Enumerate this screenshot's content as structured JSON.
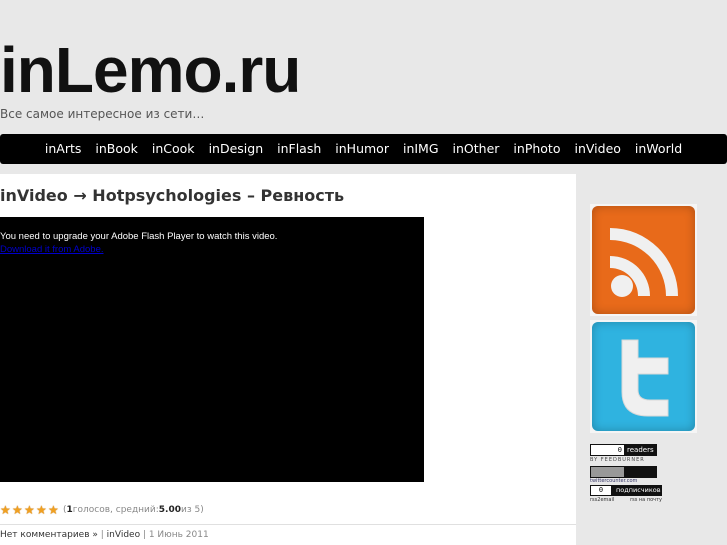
{
  "site": {
    "title": "inLemo.ru",
    "tagline": "Все самое интересное из сети…"
  },
  "nav": {
    "items": [
      "inArts",
      "inBook",
      "inCook",
      "inDesign",
      "inFlash",
      "inHumor",
      "inIMG",
      "inOther",
      "inPhoto",
      "inVideo",
      "inWorld"
    ]
  },
  "post": {
    "title": "inVideo → Hotpsychologies – Ревность",
    "video": {
      "message": "You need to upgrade your Adobe Flash Player to watch this video.",
      "download_link": "Download it from Adobe."
    },
    "rating": {
      "stars_filled": 5,
      "stars_total": 5,
      "votes": "1",
      "votes_text": " голосов, средний: ",
      "average": "5.00",
      "out_of": " из 5)"
    },
    "meta": {
      "comments": "Нет комментариев »",
      "separator1": " | ",
      "category": "inVideo",
      "separator2": " | ",
      "date": "1 Июнь 2011"
    }
  },
  "sidebar": {
    "rss_pillow_alt": "rss-pillow-icon",
    "twitter_pillow_alt": "twitter-pillow-icon",
    "feedburner": {
      "count": "0",
      "label": "readers",
      "by": "BY FEEDBURNER"
    },
    "twittercounter": {
      "by": "twittercounter.com"
    },
    "rss_counter": {
      "count": "0",
      "label": "подписчиков",
      "left": "rss2email",
      "right": "rss на почту"
    }
  },
  "colors": {
    "nav_bg": "#000000",
    "rss_orange": "#e86a1a",
    "twitter_blue": "#2fb3e0",
    "star": "#f0a020"
  }
}
